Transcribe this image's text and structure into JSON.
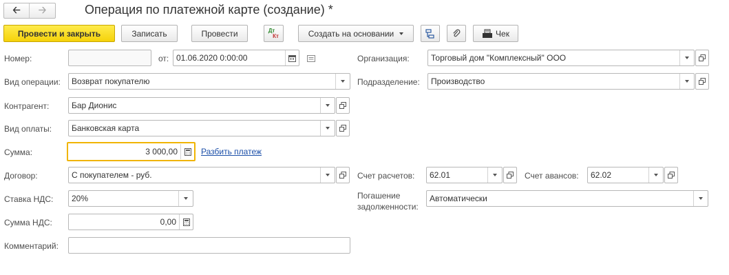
{
  "window": {
    "title": "Операция по платежной карте (создание) *"
  },
  "toolbar": {
    "post_close_label": "Провести и закрыть",
    "save_label": "Записать",
    "post_label": "Провести",
    "dtkt_top": "Дт",
    "dtkt_bottom": "Кт",
    "create_based_label": "Создать на основании",
    "receipt_label": "Чек"
  },
  "form": {
    "number": {
      "label": "Номер:",
      "value": ""
    },
    "date": {
      "label": "от:",
      "value": "01.06.2020  0:00:00"
    },
    "organization": {
      "label": "Организация:",
      "value": "Торговый дом \"Комплексный\" ООО"
    },
    "operation_type": {
      "label": "Вид операции:",
      "value": "Возврат покупателю"
    },
    "department": {
      "label": "Подразделение:",
      "value": "Производство"
    },
    "counterparty": {
      "label": "Контрагент:",
      "value": "Бар Дионис"
    },
    "payment_type": {
      "label": "Вид оплаты:",
      "value": "Банковская карта"
    },
    "amount": {
      "label": "Сумма:",
      "value": "3 000,00"
    },
    "split_payment_link": "Разбить платеж",
    "contract": {
      "label": "Договор:",
      "value": "С покупателем - руб."
    },
    "settlement_account": {
      "label": "Счет расчетов:",
      "value": "62.01"
    },
    "advance_account": {
      "label": "Счет авансов:",
      "value": "62.02"
    },
    "vat_rate": {
      "label": "Ставка НДС:",
      "value": "20%"
    },
    "debt_repayment": {
      "label_line1": "Погашение",
      "label_line2": "задолженности:",
      "value": "Автоматически"
    },
    "vat_amount": {
      "label": "Сумма НДС:",
      "value": "0,00"
    },
    "comment": {
      "label": "Комментарий:",
      "value": ""
    }
  },
  "colors": {
    "primary_button": "#f5d20a",
    "focus_border": "#f0b400",
    "link": "#1a4ea8"
  }
}
